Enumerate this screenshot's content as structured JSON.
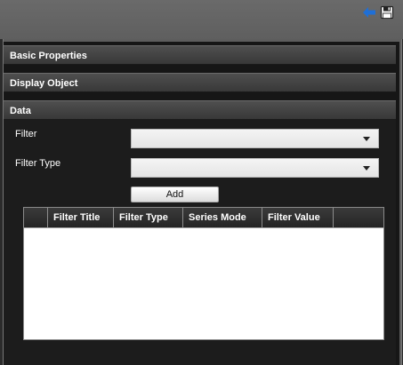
{
  "toolbar": {
    "back_icon": "back-arrow-icon",
    "save_icon": "save-disk-icon",
    "accent": "#1f6fd6"
  },
  "sections": {
    "basic_properties": "Basic Properties",
    "display_object": "Display Object",
    "data": "Data"
  },
  "data_form": {
    "filter_label": "Filter",
    "filter_value": "",
    "filter_type_label": "Filter Type",
    "filter_type_value": "",
    "add_label": "Add"
  },
  "filter_table": {
    "columns": [
      "",
      "Filter Title",
      "Filter Type",
      "Series Mode",
      "Filter Value",
      ""
    ],
    "rows": []
  }
}
